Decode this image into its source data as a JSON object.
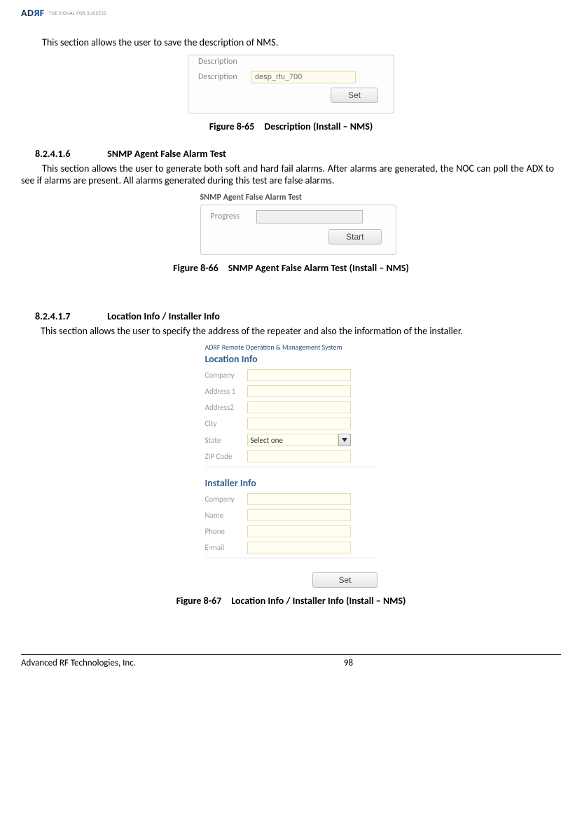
{
  "header": {
    "logo_text_a": "AD",
    "logo_text_r": "R",
    "logo_text_f": "F",
    "tagline": "THE SIGNAL FOR SUCCESS"
  },
  "intro": {
    "desc_line": "This section allows the user to save the description of NMS."
  },
  "desc_panel": {
    "title": "Description",
    "label": "Description",
    "value": "desp_rfu_700",
    "button": "Set"
  },
  "caption1": "Figure 8-65 Description (Install – NMS)",
  "section2": {
    "num": "8.2.4.1.6",
    "title": "SNMP Agent False Alarm Test",
    "body": "This section allows the user to generate both soft and hard fail alarms.  After alarms are generated, the NOC can poll the ADX to see if alarms are present.  All alarms generated during this test are false alarms."
  },
  "snmp_panel": {
    "title": "SNMP Agent False Alarm Test",
    "label": "Progress",
    "button": "Start"
  },
  "caption2": "Figure 8-66 SNMP Agent False Alarm Test (Install – NMS)",
  "section3": {
    "num": "8.2.4.1.7",
    "title": "Location Info / Installer Info",
    "body": "This section allows the user to specify the address of the repeater and also the information of the installer."
  },
  "loc_panel": {
    "super": "ADRF Remote Operation & Management System",
    "loc_heading": "Location Info",
    "fields": {
      "company": "Company",
      "address1": "Address 1",
      "address2": "Address2",
      "city": "City",
      "state": "State",
      "state_value": "Select one",
      "zip": "ZIP Code"
    },
    "inst_heading": "Installer Info",
    "inst_fields": {
      "company": "Company",
      "name": "Name",
      "phone": "Phone",
      "email": "E-mail"
    },
    "button": "Set"
  },
  "caption3": "Figure 8-67 Location Info / Installer Info (Install – NMS)",
  "footer": {
    "company": "Advanced RF Technologies, Inc.",
    "page": "98"
  }
}
